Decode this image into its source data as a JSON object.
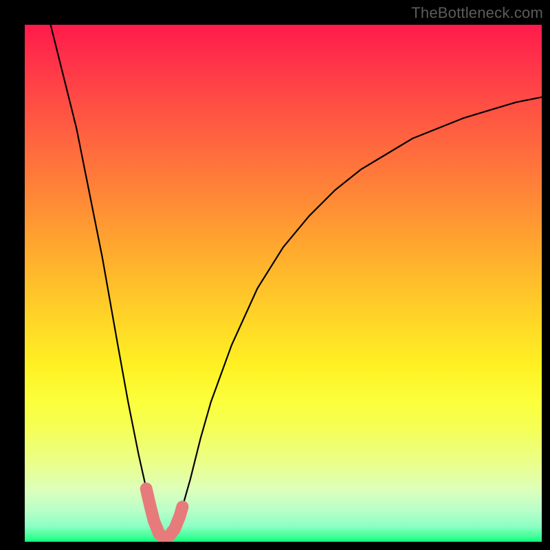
{
  "watermark": "TheBottleneck.com",
  "colors": {
    "frame": "#000000",
    "curve": "#000000",
    "highlight": "#e77b7b"
  },
  "chart_data": {
    "type": "line",
    "title": "",
    "xlabel": "",
    "ylabel": "",
    "xlim": [
      0,
      100
    ],
    "ylim": [
      0,
      100
    ],
    "grid": false,
    "comment": "V-shaped bottleneck curve. x is a normalized component-balance axis (0–100). y is bottleneck percentage (0 = no bottleneck at bottom, 100 = severe at top). Minimum near x≈27. Values read from the plotted curve relative to the gradient area.",
    "x": [
      5,
      10,
      15,
      18,
      20,
      22,
      24,
      25,
      26,
      27,
      28,
      29,
      30,
      32,
      34,
      36,
      40,
      45,
      50,
      55,
      60,
      65,
      70,
      75,
      80,
      85,
      90,
      95,
      100
    ],
    "values": [
      100,
      80,
      55,
      38,
      27,
      17,
      8,
      4,
      1.5,
      0.8,
      1.2,
      2.5,
      5,
      12,
      20,
      27,
      38,
      49,
      57,
      63,
      68,
      72,
      75,
      78,
      80,
      82,
      83.5,
      85,
      86
    ],
    "highlight_range_x": [
      23.5,
      30.5
    ],
    "highlight_comment": "Pink thick segment overlaid on the trough of the curve"
  }
}
